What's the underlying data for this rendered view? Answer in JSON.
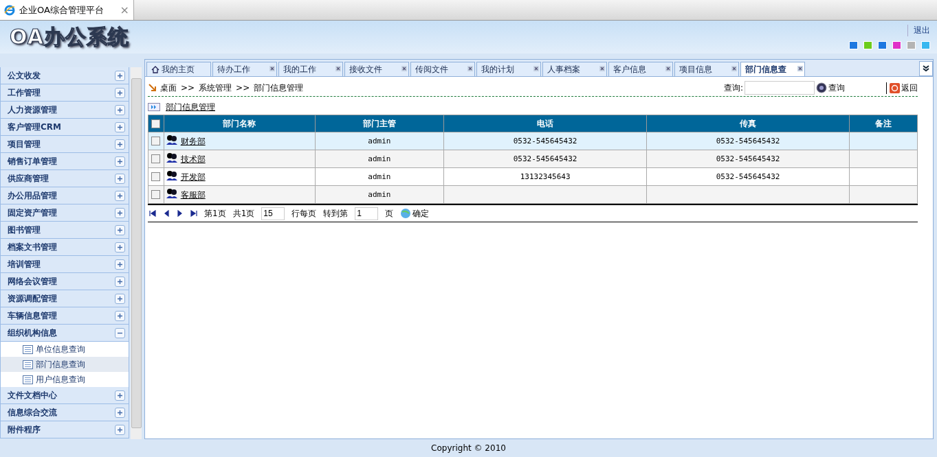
{
  "browser_tab": {
    "title": "企业OA综合管理平台",
    "close": "×"
  },
  "header": {
    "logo": "OA办公系统",
    "logout": "退出",
    "theme_swatches": [
      {
        "color": "#1e78e0"
      },
      {
        "color": "#6ccc1c"
      },
      {
        "color": "#1e78e0"
      },
      {
        "color": "#e030c8"
      },
      {
        "color": "#b4b4b4"
      },
      {
        "color": "#38b8f0"
      }
    ]
  },
  "sidebar": {
    "items": [
      {
        "label": "公文收发",
        "expanded": false
      },
      {
        "label": "工作管理",
        "expanded": false
      },
      {
        "label": "人力资源管理",
        "expanded": false
      },
      {
        "label": "客户管理CRM",
        "expanded": false
      },
      {
        "label": "项目管理",
        "expanded": false
      },
      {
        "label": "销售订单管理",
        "expanded": false
      },
      {
        "label": "供应商管理",
        "expanded": false
      },
      {
        "label": "办公用品管理",
        "expanded": false
      },
      {
        "label": "固定资产管理",
        "expanded": false
      },
      {
        "label": "图书管理",
        "expanded": false
      },
      {
        "label": "档案文书管理",
        "expanded": false
      },
      {
        "label": "培训管理",
        "expanded": false
      },
      {
        "label": "网络会议管理",
        "expanded": false
      },
      {
        "label": "资源调配管理",
        "expanded": false
      },
      {
        "label": "车辆信息管理",
        "expanded": false
      },
      {
        "label": "组织机构信息",
        "expanded": true,
        "children": [
          {
            "label": "单位信息查询",
            "selected": false
          },
          {
            "label": "部门信息查询",
            "selected": true
          },
          {
            "label": "用户信息查询",
            "selected": false
          }
        ]
      },
      {
        "label": "文件文档中心",
        "expanded": false
      },
      {
        "label": "信息综合交流",
        "expanded": false
      },
      {
        "label": "附件程序",
        "expanded": false
      }
    ]
  },
  "tabs": [
    {
      "label": "我的主页",
      "kind": "home",
      "selected": false
    },
    {
      "label": "待办工作",
      "kind": "closable",
      "selected": false
    },
    {
      "label": "我的工作",
      "kind": "closable",
      "selected": false
    },
    {
      "label": "接收文件",
      "kind": "closable",
      "selected": false
    },
    {
      "label": "传阅文件",
      "kind": "closable",
      "selected": false
    },
    {
      "label": "我的计划",
      "kind": "closable",
      "selected": false
    },
    {
      "label": "人事档案",
      "kind": "closable",
      "selected": false
    },
    {
      "label": "客户信息",
      "kind": "closable",
      "selected": false
    },
    {
      "label": "项目信息",
      "kind": "closable",
      "selected": false
    },
    {
      "label": "部门信息查",
      "kind": "closable",
      "selected": true
    }
  ],
  "breadcrumb": [
    "桌面",
    ">>",
    "系统管理",
    ">>",
    "部门信息管理"
  ],
  "search": {
    "label": "查询:",
    "button": "查询",
    "back": "返回"
  },
  "section_title": "部门信息管理",
  "table": {
    "select_all_checked": false,
    "columns": [
      "部门名称",
      "部门主管",
      "电话",
      "传真",
      "备注"
    ],
    "rows": [
      {
        "selected": true,
        "checked": false,
        "cells": [
          "财务部",
          "admin",
          "0532-545645432",
          "0532-545645432"
        ]
      },
      {
        "selected": false,
        "checked": false,
        "cells": [
          "技术部",
          "admin",
          "0532-545645432",
          "0532-545645432"
        ]
      },
      {
        "selected": false,
        "checked": false,
        "cells": [
          "开发部",
          "admin",
          "13132345643",
          "0532-545645432"
        ]
      },
      {
        "selected": false,
        "checked": false,
        "cells": [
          "客服部",
          "admin"
        ]
      }
    ]
  },
  "pagination": {
    "page": "第1页",
    "total": "共1页",
    "page_size": "15",
    "per_page": "行每页",
    "goto": "转到第",
    "goto_page": "1",
    "page_unit": "页",
    "go": "确定"
  },
  "footer": "Copyright © 2010"
}
